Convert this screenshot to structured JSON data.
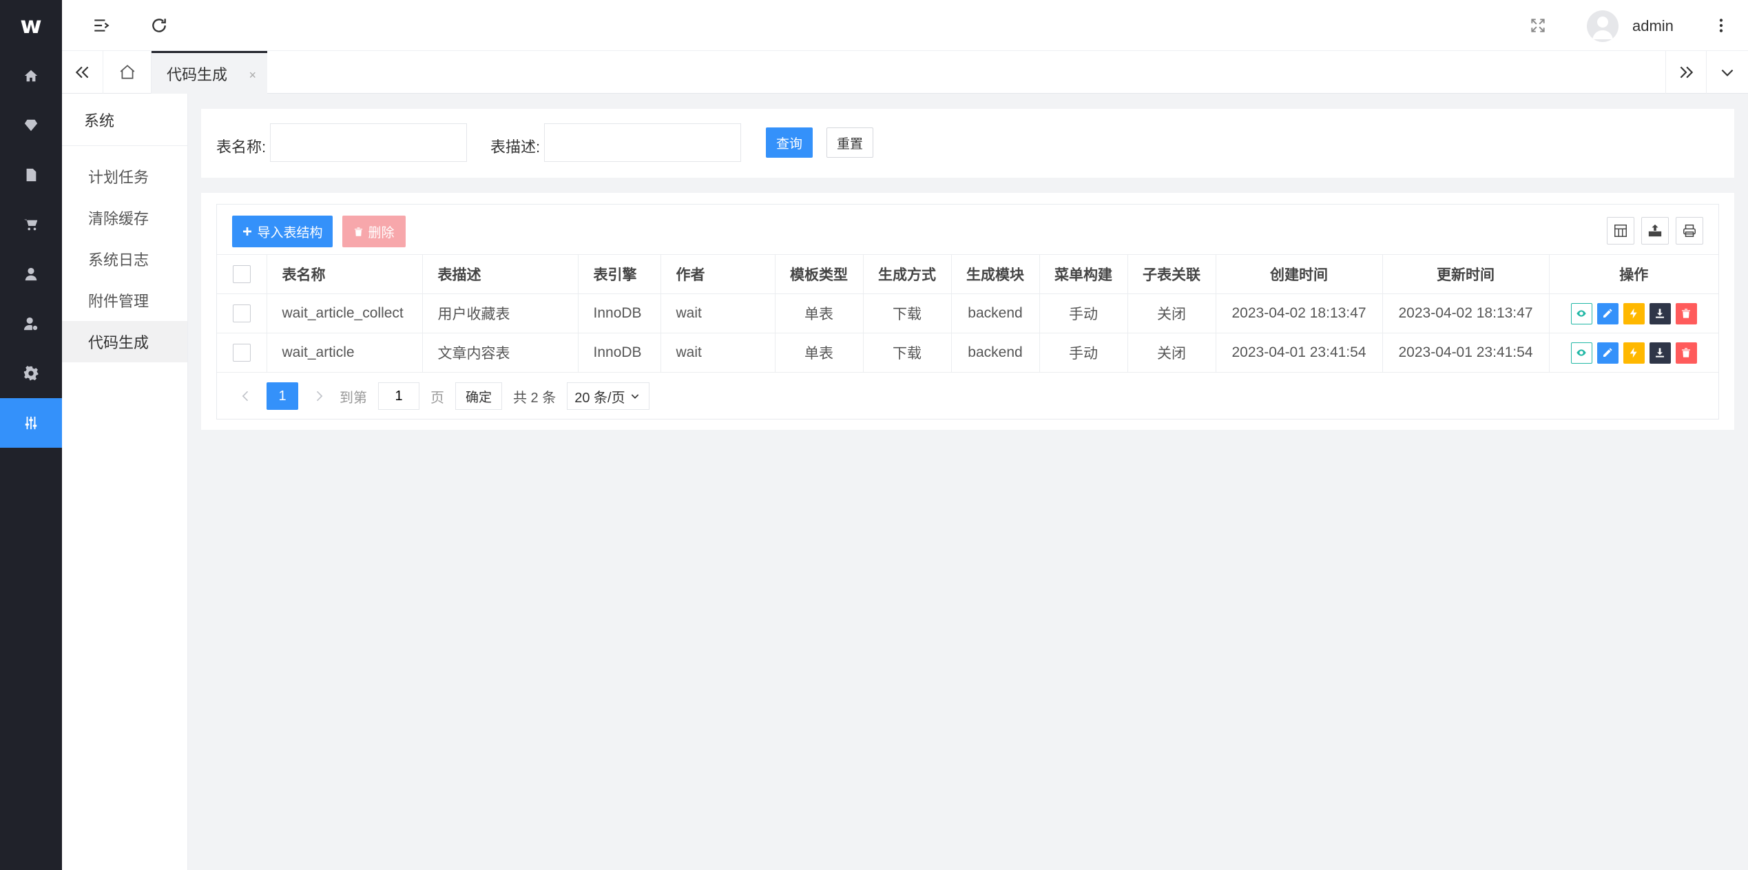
{
  "app": {
    "logo_text": "w"
  },
  "rail": {
    "items": [
      {
        "icon": "home-icon",
        "active": false
      },
      {
        "icon": "diamond-icon",
        "active": false
      },
      {
        "icon": "document-icon",
        "active": false
      },
      {
        "icon": "cart-icon",
        "active": false
      },
      {
        "icon": "user-icon",
        "active": false
      },
      {
        "icon": "user-settings-icon",
        "active": false
      },
      {
        "icon": "gear-icon",
        "active": false
      },
      {
        "icon": "sliders-icon",
        "active": true
      }
    ]
  },
  "header": {
    "user_name": "admin",
    "icons": [
      "menu-toggle-icon",
      "refresh-icon",
      "fullscreen-icon",
      "more-icon"
    ]
  },
  "tabs": {
    "active_tab": "代码生成",
    "close_glyph": "×"
  },
  "submenu": {
    "title": "系统",
    "items": [
      {
        "label": "计划任务",
        "active": false
      },
      {
        "label": "清除缓存",
        "active": false
      },
      {
        "label": "系统日志",
        "active": false
      },
      {
        "label": "附件管理",
        "active": false
      },
      {
        "label": "代码生成",
        "active": true
      }
    ]
  },
  "search": {
    "table_name_label": "表名称:",
    "table_name_value": "",
    "table_desc_label": "表描述:",
    "table_desc_value": "",
    "query_button": "查询",
    "reset_button": "重置"
  },
  "toolbar": {
    "import_button": "导入表结构",
    "delete_button": "删除"
  },
  "table": {
    "columns": [
      "表名称",
      "表描述",
      "表引擎",
      "作者",
      "模板类型",
      "生成方式",
      "生成模块",
      "菜单构建",
      "子表关联",
      "创建时间",
      "更新时间",
      "操作"
    ],
    "rows": [
      [
        "wait_article_collect",
        "用户收藏表",
        "InnoDB",
        "wait",
        "单表",
        "下载",
        "backend",
        "手动",
        "关闭",
        "2023-04-02 18:13:47",
        "2023-04-02 18:13:47"
      ],
      [
        "wait_article",
        "文章内容表",
        "InnoDB",
        "wait",
        "单表",
        "下载",
        "backend",
        "手动",
        "关闭",
        "2023-04-01 23:41:54",
        "2023-04-01 23:41:54"
      ]
    ]
  },
  "pager": {
    "current_page": "1",
    "goto_label": "到第",
    "goto_value": "1",
    "page_unit": "页",
    "confirm_button": "确定",
    "total_text": "共 2 条",
    "page_size": "20 条/页"
  },
  "colors": {
    "primary": "#3491fa",
    "rail_bg": "#20222a",
    "danger_light": "#f7a7ab",
    "view": "#22b8a6",
    "generate": "#ffb800",
    "download": "#2f3648",
    "remove": "#ff5b5b"
  }
}
